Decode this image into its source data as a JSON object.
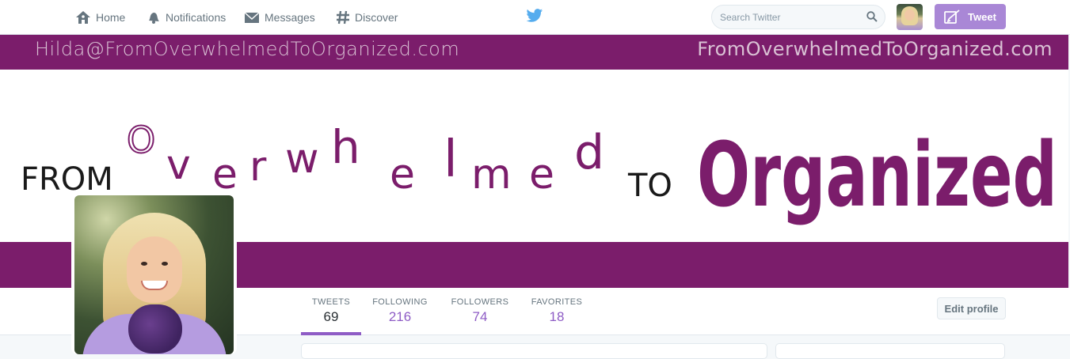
{
  "topbar": {
    "nav": [
      {
        "label": "Home",
        "icon": "home-icon"
      },
      {
        "label": "Notifications",
        "icon": "bell-icon"
      },
      {
        "label": "Messages",
        "icon": "envelope-icon"
      },
      {
        "label": "Discover",
        "icon": "hashtag-icon"
      }
    ],
    "search_placeholder": "Search Twitter",
    "tweet_label": "Tweet"
  },
  "banner": {
    "email": "Hilda@FromOverwhelmedToOrganized.com",
    "domain": "FromOverwhelmedToOrganized.com",
    "from": "FROM",
    "overwhelmed": [
      "O",
      "v",
      "e",
      "r",
      "w",
      "h",
      "e",
      "l",
      "m",
      "e",
      "d"
    ],
    "to": "TO",
    "organized": "Organized"
  },
  "profile": {
    "stats": [
      {
        "label": "TWEETS",
        "value": "69"
      },
      {
        "label": "FOLLOWING",
        "value": "216"
      },
      {
        "label": "FOLLOWERS",
        "value": "74"
      },
      {
        "label": "FAVORITES",
        "value": "18"
      }
    ],
    "edit_label": "Edit profile"
  },
  "colors": {
    "accent": "#8e5cc5",
    "banner_band": "#7b1d6b",
    "twitter_blue": "#55acee"
  }
}
